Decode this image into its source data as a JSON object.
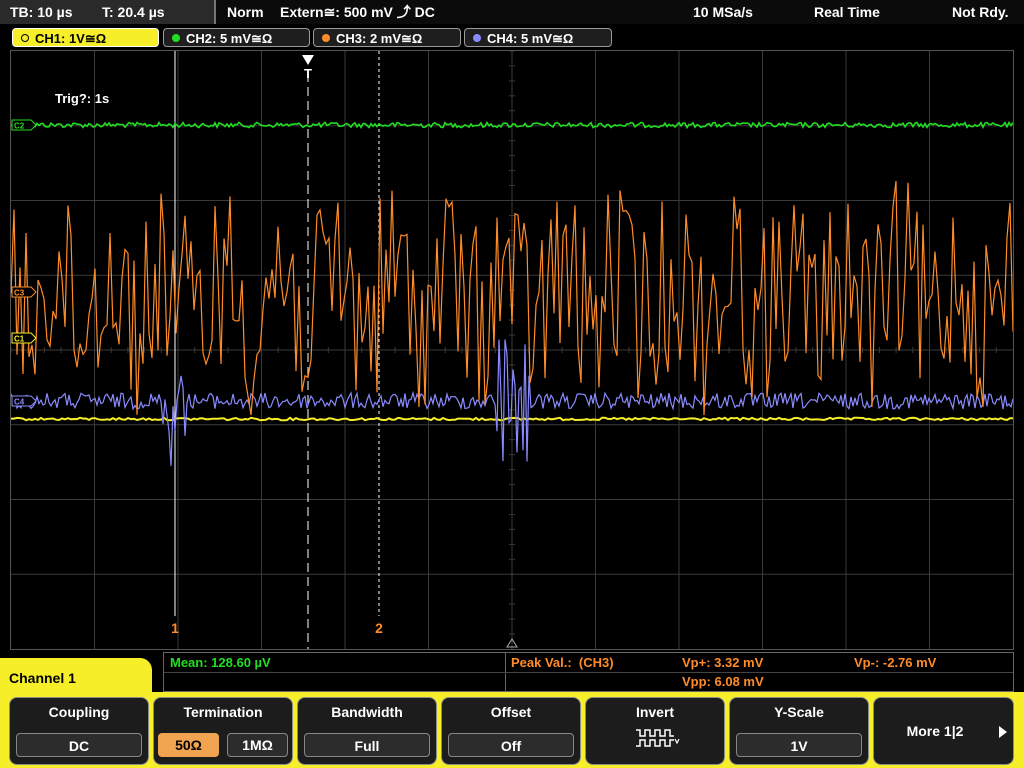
{
  "status_bar": {
    "timebase": "TB: 10 µs",
    "trigger_time": "T: 20.4 µs",
    "mode": "Norm",
    "trigger_source": "Extern≅: 500 mV ⤴ DC",
    "sample_rate": "10 MSa/s",
    "acq_mode": "Real Time",
    "state": "Not Rdy."
  },
  "channel_tabs": [
    {
      "label": "CH1: 1V≅Ω",
      "color": "#f6ee28"
    },
    {
      "label": "CH2: 5 mV≅Ω",
      "color": "#22dd22"
    },
    {
      "label": "CH3: 2 mV≅Ω",
      "color": "#ff8c28"
    },
    {
      "label": "CH4: 5 mV≅Ω",
      "color": "#8a8aff"
    }
  ],
  "screen": {
    "trigger_status": "Trig?: 1s",
    "trigger_marker": "T",
    "cursor1_label": "1",
    "cursor2_label": "2",
    "markers": {
      "ch2": "C2",
      "ch3": "C3",
      "ch1": "C1",
      "ch4": "C4"
    }
  },
  "readout": {
    "mean": "Mean: 128.60 µV",
    "peak_label": "Peak Val.:  (CH3)",
    "vp_plus": "Vp+: 3.32 mV",
    "vp_minus": "Vp-: -2.76 mV",
    "vpp": "Vpp: 6.08 mV"
  },
  "menu": {
    "title": "Channel 1",
    "coupling": {
      "title": "Coupling",
      "value": "DC"
    },
    "termination": {
      "title": "Termination",
      "opt1": "50Ω",
      "opt2": "1MΩ"
    },
    "bandwidth": {
      "title": "Bandwidth",
      "value": "Full"
    },
    "offset": {
      "title": "Offset",
      "value": "Off"
    },
    "invert": {
      "title": "Invert"
    },
    "yscale": {
      "title": "Y-Scale",
      "value": "1V"
    },
    "more": {
      "label": "More 1|2"
    }
  },
  "colors": {
    "ch1": "#f6ee28",
    "ch2": "#22dd22",
    "ch3": "#ff8c28",
    "ch4": "#8a8aff",
    "menu_accent": "#f6ee28",
    "selected_option": "#f0a450"
  }
}
